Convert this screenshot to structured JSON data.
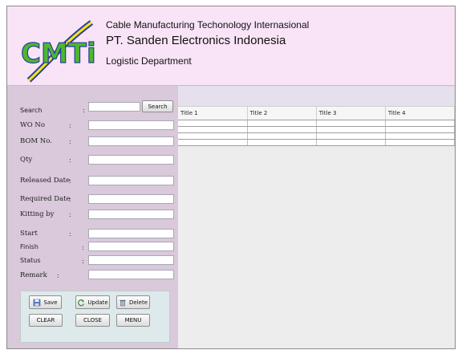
{
  "header": {
    "company_line": "Cable Manufacturing Techonology Internasional",
    "company_name": "PT. Sanden Electronics Indonesia",
    "department": "Logistic Department",
    "logo_text": "CMTi"
  },
  "form": {
    "search_label": "Search",
    "search_button": "Search",
    "wo_label": "WO No",
    "bom_label": "BOM No.",
    "qty_label": "Qty",
    "released_label": "Released Date",
    "required_label": "Required Date",
    "kitting_label": "Kitting by",
    "start_label": "Start",
    "finish_label": "Finish",
    "status_label": "Status",
    "remark_label": "Remark",
    "colon": ":"
  },
  "buttons": {
    "save": "Save",
    "update": "Update",
    "delete": "Delete",
    "clear": "CLEAR",
    "close": "CLOSE",
    "menu": "MENU"
  },
  "table": {
    "columns": [
      "Title 1",
      "Title 2",
      "Title 3",
      "Title 4"
    ],
    "rows": [
      [
        "",
        "",
        "",
        ""
      ],
      [
        "",
        "",
        "",
        ""
      ],
      [
        "",
        "",
        "",
        ""
      ],
      [
        "",
        "",
        "",
        ""
      ]
    ]
  },
  "colors": {
    "header_bg": "#f8e4f6",
    "sidebar_bg": "#d9c9da",
    "logo_green": "#4bb82f",
    "logo_blue": "#2a3f9c",
    "logo_yellow": "#f4e31a"
  }
}
